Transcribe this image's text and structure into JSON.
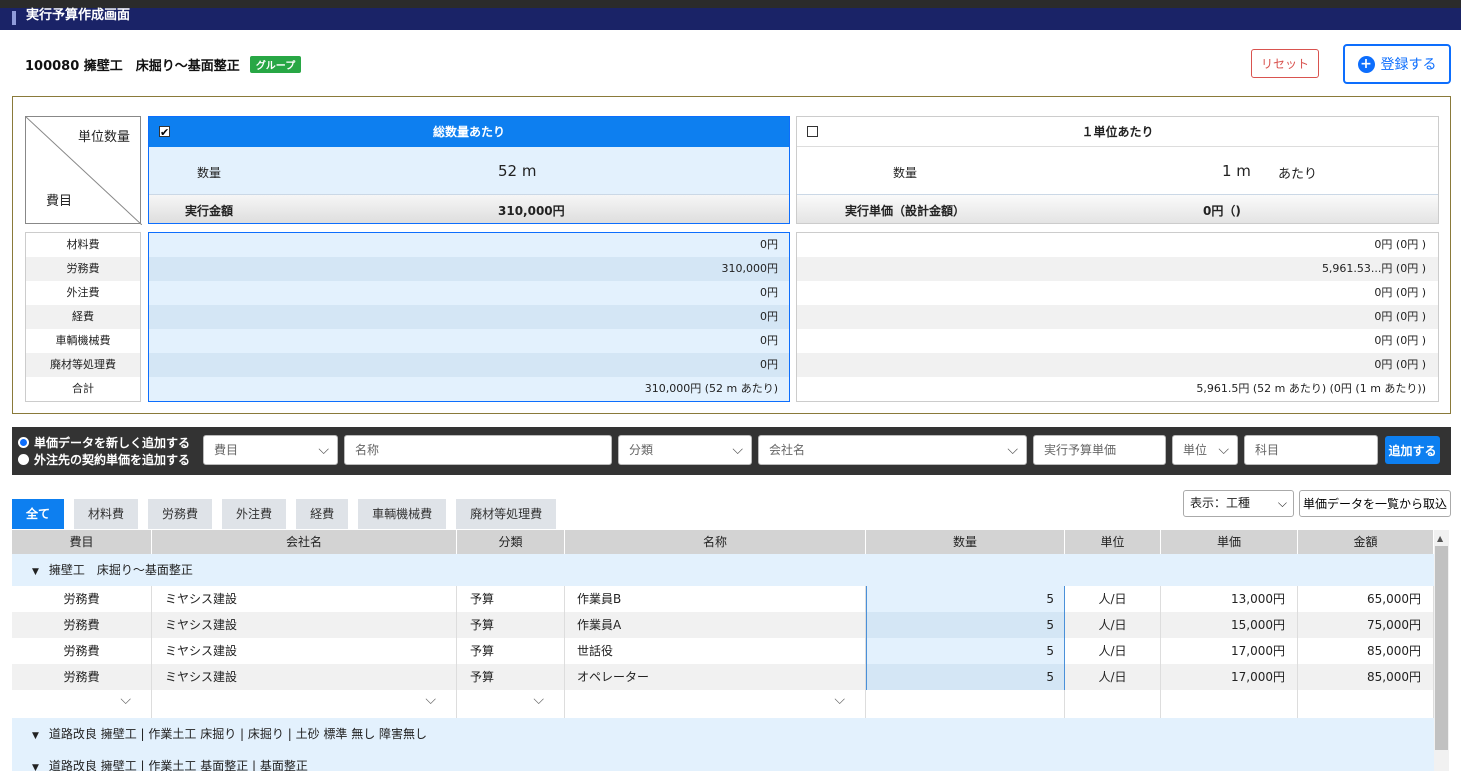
{
  "window": {
    "title": "実行予算作成画面"
  },
  "header": {
    "code_name": "100080 擁壁工　床掘り〜基面整正",
    "badge": "グループ",
    "reset_label": "リセット",
    "register_label": "登録する"
  },
  "summary": {
    "diag_top": "単位数量",
    "diag_bottom": "費目",
    "total": {
      "title": "総数量あたり",
      "qty_label": "数量",
      "qty_value": "52 m",
      "amount_label": "実行金額",
      "amount_value": "310,000円"
    },
    "unit": {
      "title": "１単位あたり",
      "qty_label": "数量",
      "qty_value": "1 m",
      "qty_suffix": "あたり",
      "amount_label": "実行単価（設計金額）",
      "amount_value": "0円（)"
    },
    "cost_labels": [
      "材料費",
      "労務費",
      "外注費",
      "経費",
      "車輌機械費",
      "廃材等処理費",
      "合計"
    ],
    "cost_total": [
      "0円",
      "310,000円",
      "0円",
      "0円",
      "0円",
      "0円",
      "310,000円 (52 m あたり)"
    ],
    "cost_unit": [
      "0円 (0円 )",
      "5,961.53...円 (0円 )",
      "0円 (0円 )",
      "0円 (0円 )",
      "0円 (0円 )",
      "0円 (0円 )",
      "5,961.5円 (52 m あたり) (0円 (1 m あたり))"
    ]
  },
  "add_bar": {
    "radio_new": "単価データを新しく追加する",
    "radio_contract": "外注先の契約単価を追加する",
    "field_cost": "費目",
    "field_name": "名称",
    "field_class": "分類",
    "field_company": "会社名",
    "field_price": "実行予算単価",
    "field_unit": "単位",
    "field_subject": "科目",
    "add_label": "追加する"
  },
  "tabs": [
    "全て",
    "材料費",
    "労務費",
    "外注費",
    "経費",
    "車輌機械費",
    "廃材等処理費"
  ],
  "view_select": "表示：工種",
  "import_label": "単価データを一覧から取込",
  "grid": {
    "columns": [
      "費目",
      "会社名",
      "分類",
      "名称",
      "数量",
      "単位",
      "単価",
      "金額"
    ],
    "group1": "擁壁工　床掘り〜基面整正",
    "rows": [
      {
        "cost": "労務費",
        "company": "ミヤシス建設",
        "class": "予算",
        "name": "作業員B",
        "qty": "5",
        "unit": "人/日",
        "price": "13,000円",
        "amount": "65,000円"
      },
      {
        "cost": "労務費",
        "company": "ミヤシス建設",
        "class": "予算",
        "name": "作業員A",
        "qty": "5",
        "unit": "人/日",
        "price": "15,000円",
        "amount": "75,000円"
      },
      {
        "cost": "労務費",
        "company": "ミヤシス建設",
        "class": "予算",
        "name": "世話役",
        "qty": "5",
        "unit": "人/日",
        "price": "17,000円",
        "amount": "85,000円"
      },
      {
        "cost": "労務費",
        "company": "ミヤシス建設",
        "class": "予算",
        "name": "オペレーター",
        "qty": "5",
        "unit": "人/日",
        "price": "17,000円",
        "amount": "85,000円"
      }
    ],
    "group2": "道路改良 擁壁工 | 作業土工 床掘り | 床掘り | 土砂 標準 無し 障害無し",
    "group3": "道路改良 擁壁工 | 作業土工 基面整正 | 基面整正"
  }
}
